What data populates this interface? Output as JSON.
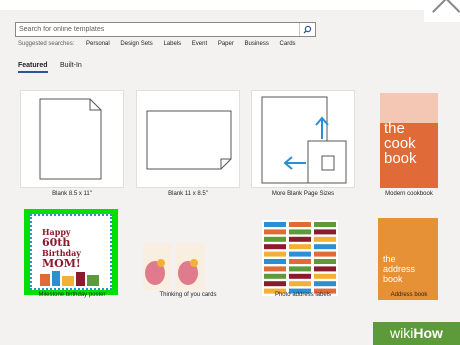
{
  "search": {
    "placeholder": "Search for online templates"
  },
  "suggested": {
    "label": "Suggested searches:",
    "items": [
      "Personal",
      "Design Sets",
      "Labels",
      "Event",
      "Paper",
      "Business",
      "Cards"
    ]
  },
  "tabs": [
    {
      "label": "Featured",
      "active": true
    },
    {
      "label": "Built-In",
      "active": false
    }
  ],
  "templates": [
    {
      "label": "Blank 8.5 x 11\""
    },
    {
      "label": "Blank 11 x 8.5\""
    },
    {
      "label": "More Blank Page Sizes"
    },
    {
      "label": "Modern cookbook"
    },
    {
      "label": "Milestone birthday poster"
    },
    {
      "label": "Thinking of you cards"
    },
    {
      "label": "Photo address labels"
    },
    {
      "label": "Address book"
    }
  ],
  "cookbook": {
    "line1": "the",
    "line2": "cook",
    "line3": "book"
  },
  "addressbook": {
    "line1": "the",
    "line2": "address",
    "line3": "book"
  },
  "birthday": {
    "line1": "Happy",
    "line2": "60th",
    "line3": "Birthday",
    "line4": "MOM!"
  },
  "watermark": {
    "wiki": "wiki",
    "how": "How"
  },
  "colors": {
    "accent": "#2b579a",
    "selection": "#00e000",
    "cookbook": "#e06b39",
    "addressbook": "#e69135"
  }
}
